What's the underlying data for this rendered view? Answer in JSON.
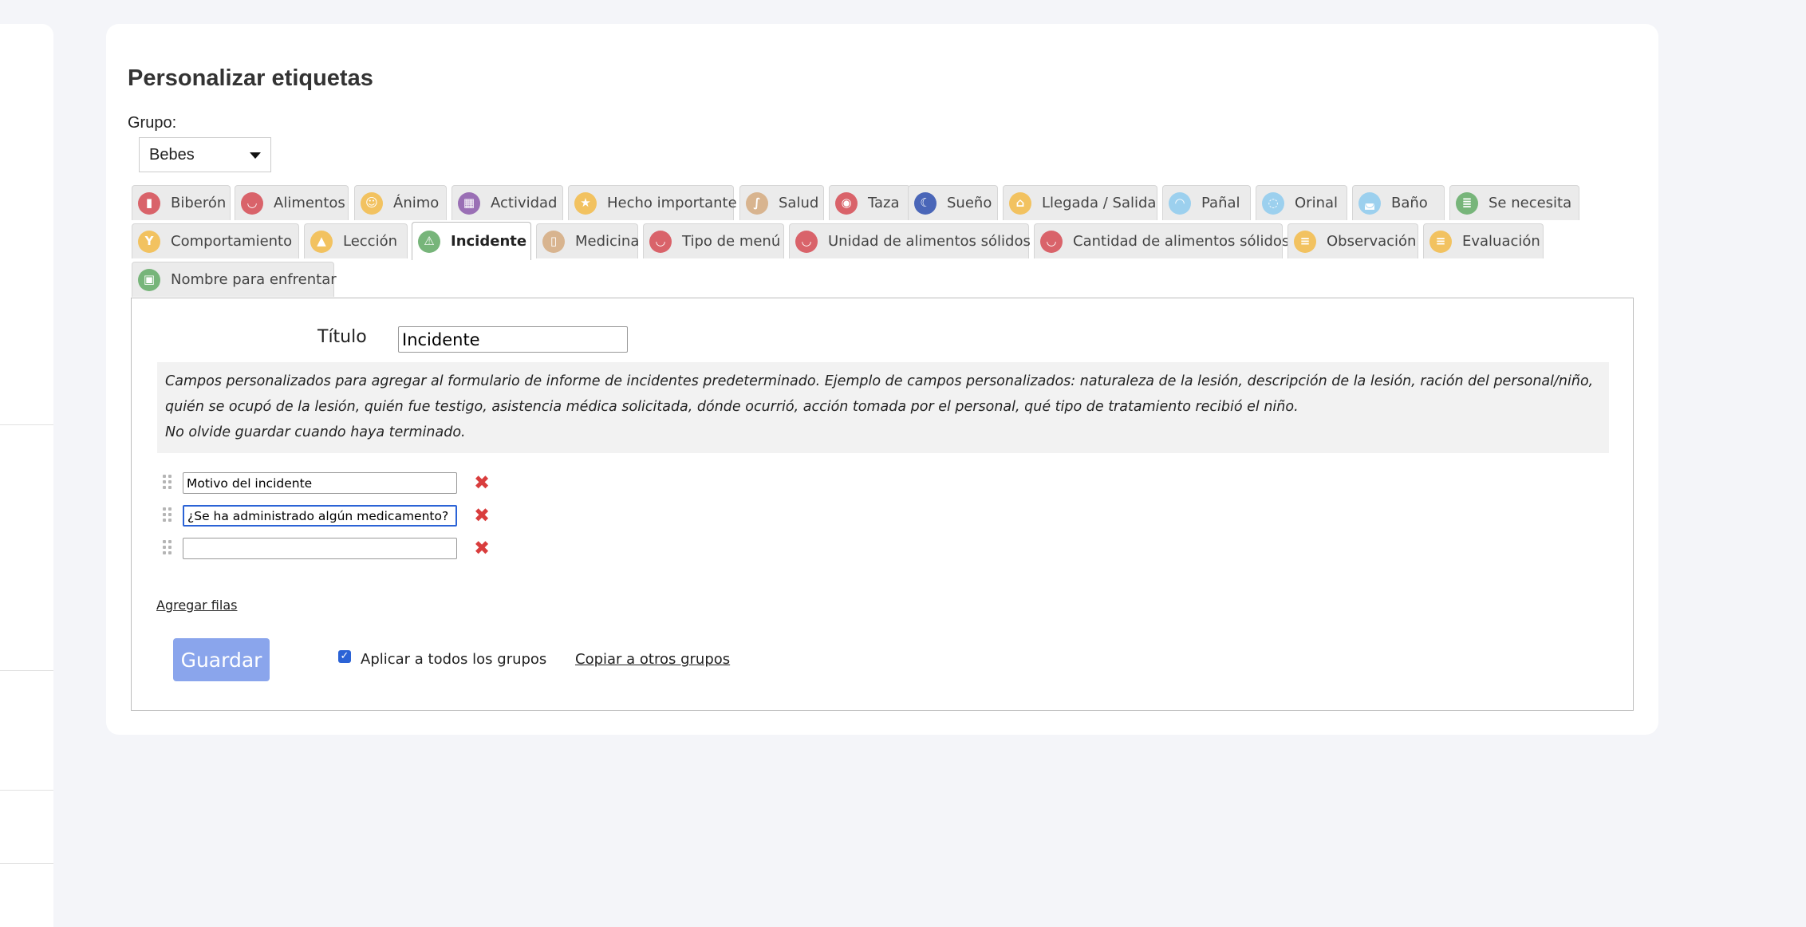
{
  "page": {
    "title": "Personalizar etiquetas",
    "group_label": "Grupo:",
    "group_selected": "Bebes"
  },
  "tabs": [
    {
      "label": "Biberón",
      "icon": "baby-bottle-icon",
      "color": "#d9636a"
    },
    {
      "label": "Alimentos",
      "icon": "bowl-icon",
      "color": "#d9636a"
    },
    {
      "label": "Ánimo",
      "icon": "mood-icon",
      "color": "#f2c260"
    },
    {
      "label": "Actividad",
      "icon": "blocks-icon",
      "color": "#9a6fb5"
    },
    {
      "label": "Hecho importante",
      "icon": "star-icon",
      "color": "#f2c260"
    },
    {
      "label": "Salud",
      "icon": "stethoscope-icon",
      "color": "#d8b48f"
    },
    {
      "label": "Taza",
      "icon": "sippy-cup-icon",
      "color": "#d9636a"
    },
    {
      "label": "Sueño",
      "icon": "moon-icon",
      "color": "#4a66b8"
    },
    {
      "label": "Llegada / Salida",
      "icon": "house-icon",
      "color": "#f2c260"
    },
    {
      "label": "Pañal",
      "icon": "diaper-icon",
      "color": "#9cd0ee"
    },
    {
      "label": "Orinal",
      "icon": "potty-icon",
      "color": "#9cd0ee"
    },
    {
      "label": "Baño",
      "icon": "bathtub-icon",
      "color": "#9cd0ee"
    },
    {
      "label": "Se necesita",
      "icon": "checklist-icon",
      "color": "#77b57a"
    },
    {
      "label": "Comportamiento",
      "icon": "behavior-icon",
      "color": "#f2c260"
    },
    {
      "label": "Lección",
      "icon": "graduation-cap-icon",
      "color": "#f2c260"
    },
    {
      "label": "Incidente",
      "icon": "warning-icon",
      "color": "#77b57a"
    },
    {
      "label": "Medicina",
      "icon": "medicine-bottle-icon",
      "color": "#d8b48f"
    },
    {
      "label": "Tipo de menú",
      "icon": "bowl-icon",
      "color": "#d9636a"
    },
    {
      "label": "Unidad de alimentos sólidos",
      "icon": "bowl-icon",
      "color": "#d9636a"
    },
    {
      "label": "Cantidad de alimentos sólidos",
      "icon": "bowl-icon",
      "color": "#d9636a"
    },
    {
      "label": "Observación",
      "icon": "notepad-icon",
      "color": "#f2c260"
    },
    {
      "label": "Evaluación",
      "icon": "notepad-icon",
      "color": "#f2c260"
    },
    {
      "label": "Nombre para enfrentar",
      "icon": "face-name-icon",
      "color": "#77b57a"
    }
  ],
  "active_tab": "Incidente",
  "form": {
    "title_label": "Título",
    "title_value": "Incidente",
    "info_line1": "Campos personalizados para agregar al formulario de informe de incidentes predeterminado. Ejemplo de campos personalizados: naturaleza de la lesión, descripción de la lesión, ración del personal/niño,",
    "info_line2": "quién se ocupó de la lesión, quién fue testigo, asistencia médica solicitada, dónde ocurrió, acción tomada por el personal, qué tipo de tratamiento recibió el niño.",
    "info_line3": "No olvide guardar cuando haya terminado.",
    "rows": [
      {
        "value": "Motivo del incidente"
      },
      {
        "value": "¿Se ha administrado algún medicamento?"
      },
      {
        "value": ""
      }
    ],
    "add_rows": "Agregar filas",
    "save": "Guardar",
    "apply_all": "Aplicar a todos los grupos",
    "apply_all_checked": true,
    "copy_groups": "Copiar a otros grupos"
  }
}
